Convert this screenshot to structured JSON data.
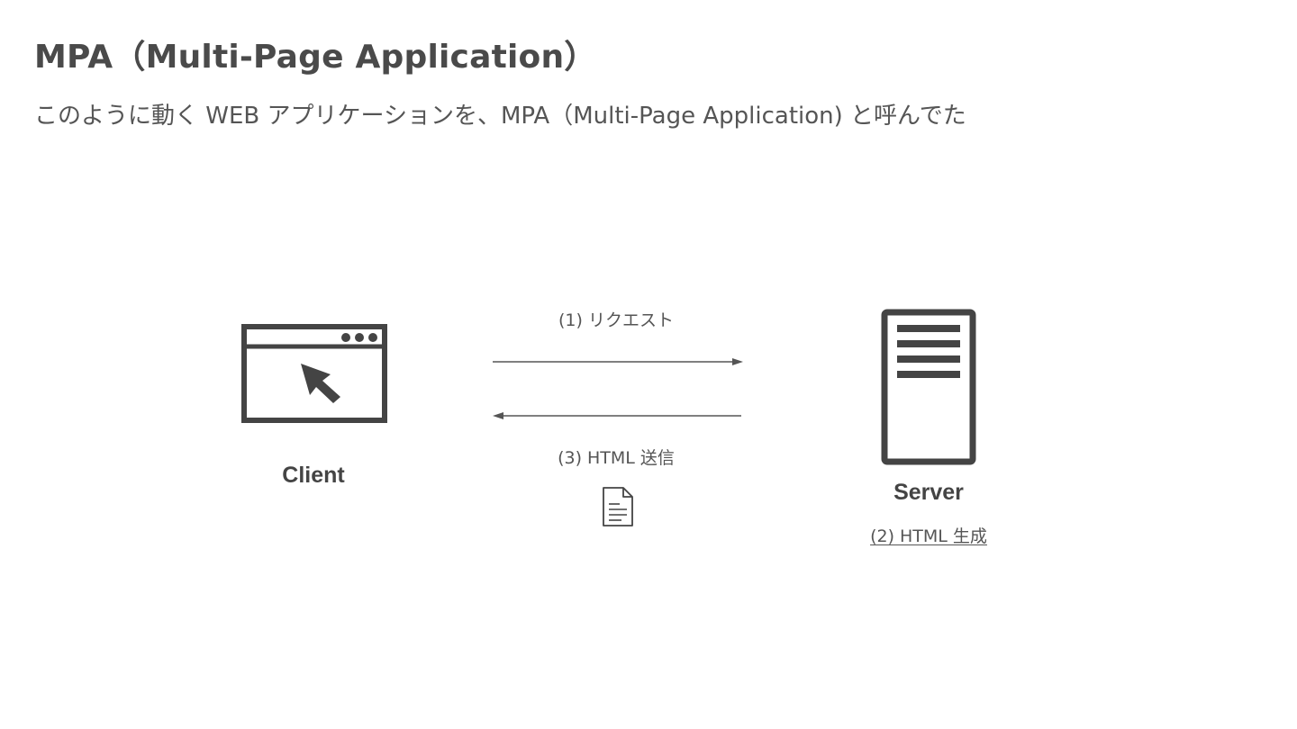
{
  "slide": {
    "title": "MPA（Multi-Page Application）",
    "subtitle": "このように動く WEB アプリケーションを、MPA（Multi-Page Application) と呼んでた"
  },
  "diagram": {
    "client": {
      "label": "Client",
      "icon": "browser-window-cursor-icon"
    },
    "server": {
      "label": "Server",
      "icon": "server-tower-icon",
      "note": "(2) HTML 生成"
    },
    "request": {
      "label": "(1) リクエスト",
      "direction": "client-to-server"
    },
    "response": {
      "label": "(3) HTML 送信",
      "direction": "server-to-client",
      "icon": "document-icon"
    }
  },
  "colors": {
    "icon": "#444444",
    "text": "#555555",
    "title": "#4a4a4a",
    "arrow": "#555555",
    "background": "#ffffff"
  }
}
